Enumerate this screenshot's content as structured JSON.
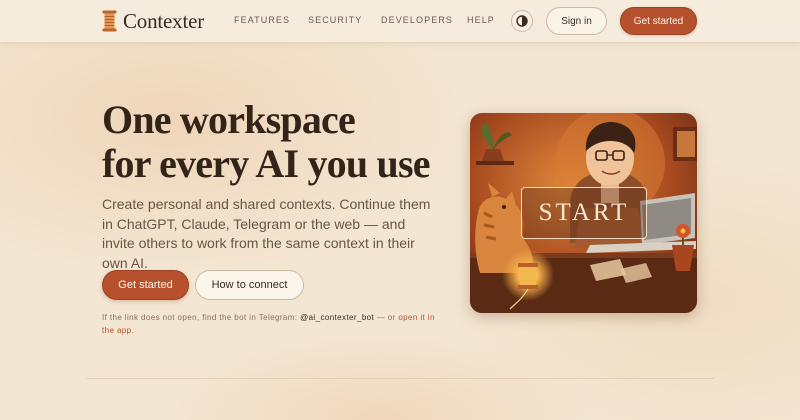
{
  "brand": {
    "name": "Contexter",
    "logo_icon": "spool-icon",
    "accent": "#b6502d"
  },
  "nav": {
    "items": [
      {
        "label": "FEATURES"
      },
      {
        "label": "SECURITY"
      },
      {
        "label": "DEVELOPERS"
      },
      {
        "label": "HELP"
      }
    ],
    "theme_toggle_icon": "contrast-icon",
    "signin_label": "Sign in",
    "getstarted_label": "Get started"
  },
  "hero": {
    "title_line1": "One workspace",
    "title_line2": "for every AI you use",
    "subtitle": "Create personal and shared contexts. Continue them in ChatGPT, Claude, Telegram or the web — and invite others to work from the same context in their own AI.",
    "primary_button": "Get started",
    "secondary_button": "How to connect",
    "note_prefix": "If the link does not open, find the bot in Telegram:",
    "note_handle": "@ai_contexter_bot",
    "note_middle": "— or",
    "note_link": "open it in the app."
  },
  "illustration": {
    "label": "START",
    "description_icon": "person-with-cat-at-laptop-illustration"
  }
}
